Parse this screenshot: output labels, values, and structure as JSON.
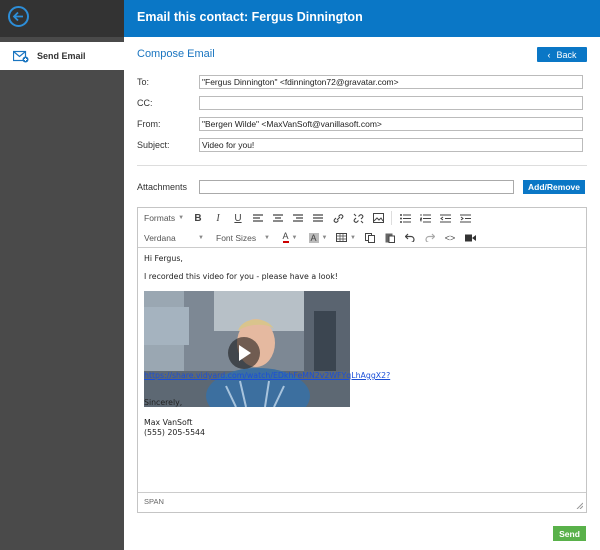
{
  "header": {
    "title": "Email this contact: Fergus Dinnington"
  },
  "sidebar": {
    "items": [
      {
        "label": "Send Email",
        "icon": "send-email-icon"
      }
    ]
  },
  "compose": {
    "title": "Compose Email",
    "back_label": "Back",
    "to_label": "To:",
    "to_value": "\"Fergus Dinnington\" <fdinnington72@gravatar.com>",
    "cc_label": "CC:",
    "cc_value": "",
    "from_label": "From:",
    "from_value": "\"Bergen Wilde\" <MaxVanSoft@vanillasoft.com>",
    "subject_label": "Subject:",
    "subject_value": "Video for you!",
    "attachments_label": "Attachments",
    "attach_button": "Add/Remove",
    "send_button": "Send"
  },
  "toolbar": {
    "formats": "Formats",
    "font": "Verdana",
    "font_sizes": "Font Sizes"
  },
  "body": {
    "greeting": "Hi Fergus,",
    "intro": "I recorded this video for you - please have a look!",
    "link": "https://share.vidyard.com/watch/EDkhFeMN2v2WFYqLhAggX2?",
    "closing": "Sincerely,",
    "name": "Max VanSoft",
    "phone": "(555) 205-5544"
  },
  "status": {
    "path": "SPAN"
  },
  "colors": {
    "brand_blue": "#0a77c6",
    "send_green": "#59b14a",
    "sidebar": "#4a4a4a"
  }
}
